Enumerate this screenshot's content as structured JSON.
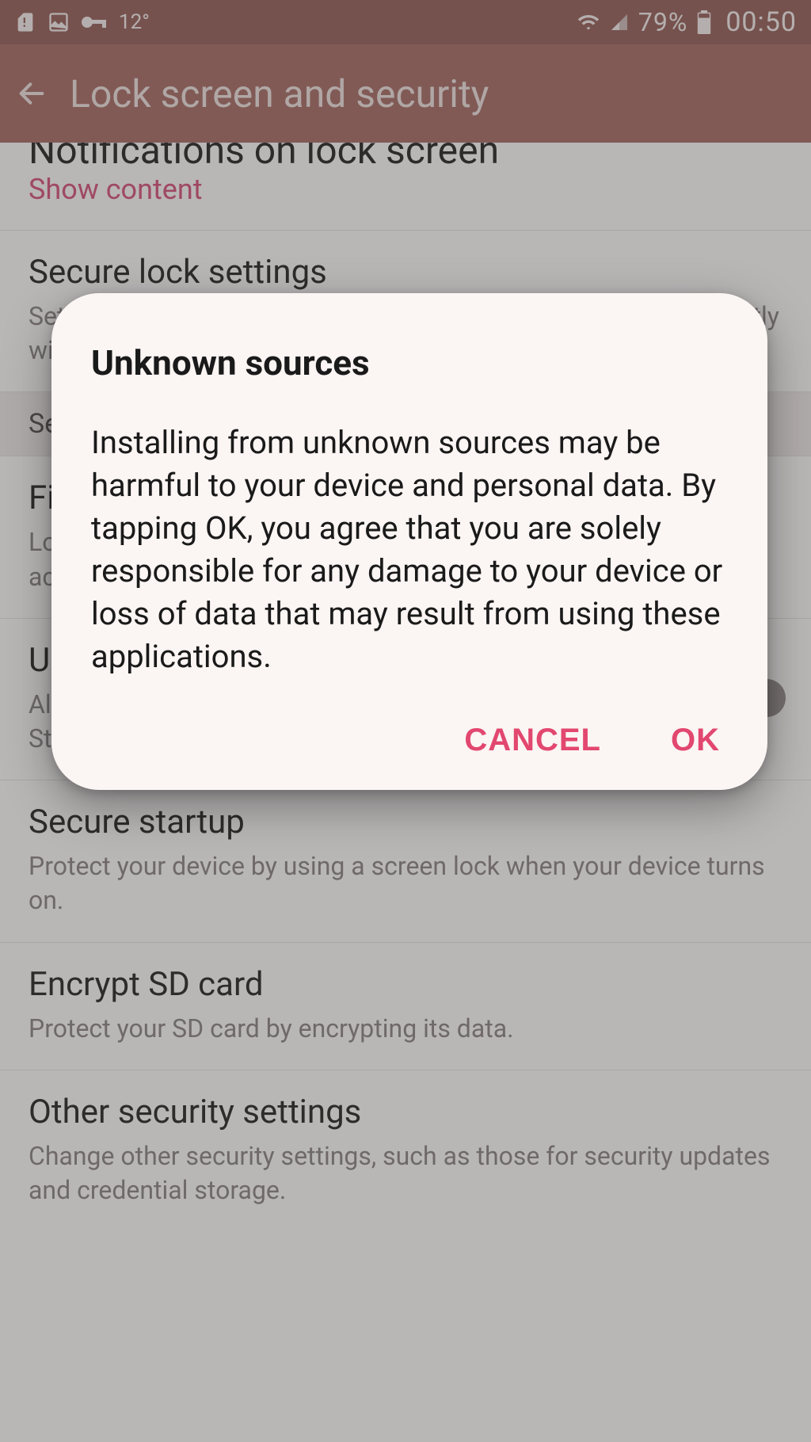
{
  "status_bar": {
    "temp": "12°",
    "battery_pct": "79%",
    "time": "00:50"
  },
  "app_bar": {
    "title": "Lock screen and security"
  },
  "list": {
    "notifications": {
      "title": "Notifications on lock screen",
      "value": "Show content"
    },
    "secure_lock": {
      "title": "Secure lock settings",
      "sub": "Set your secure lock functions, such as auto lock and lock instantly with power key."
    },
    "section_security": "Security",
    "find_my_mobile": {
      "title": "Find My Mobile",
      "sub": "Locate and control your device remotely using your Samsung account."
    },
    "unknown_sources": {
      "title": "Unknown sources",
      "sub": "Allow installation of apps from sources other than the Play Store."
    },
    "secure_startup": {
      "title": "Secure startup",
      "sub": "Protect your device by using a screen lock when your device turns on."
    },
    "encrypt_sd": {
      "title": "Encrypt SD card",
      "sub": "Protect your SD card by encrypting its data."
    },
    "other_security": {
      "title": "Other security settings",
      "sub": "Change other security settings, such as those for security updates and credential storage."
    }
  },
  "dialog": {
    "title": "Unknown sources",
    "body": "Installing from unknown sources may be harmful to your device and personal data. By tapping OK, you agree that you are solely responsible for any damage to your device or loss of data that may result from using these applications.",
    "cancel": "CANCEL",
    "ok": "OK"
  }
}
